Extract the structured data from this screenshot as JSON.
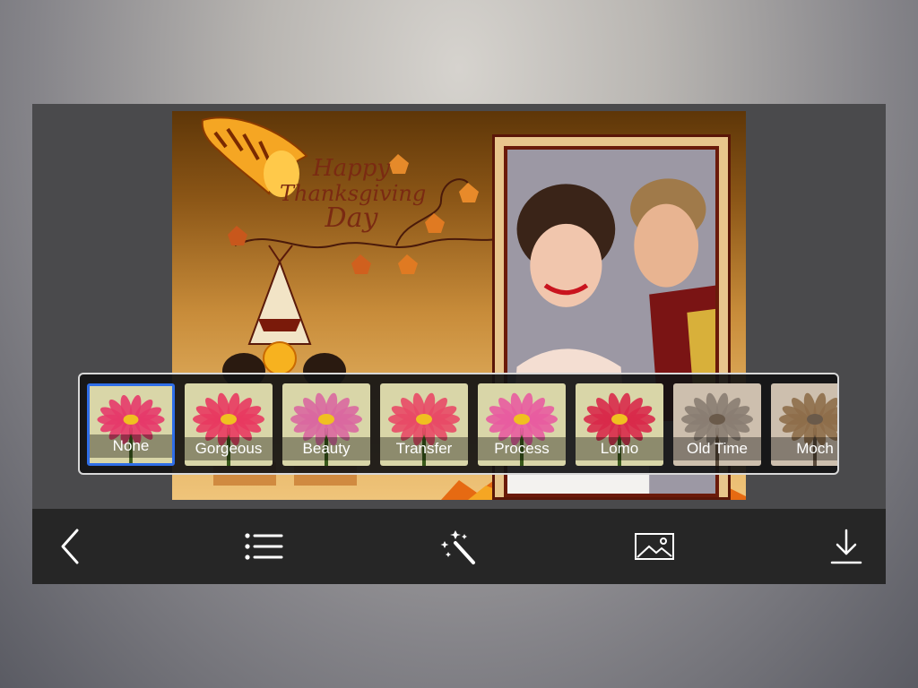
{
  "card": {
    "greeting_line1": "Happy",
    "greeting_line2": "Thanksgiving",
    "greeting_line3": "Day"
  },
  "filters": [
    {
      "label": "None",
      "selected": true,
      "tone": "#e63a6a"
    },
    {
      "label": "Gorgeous",
      "selected": false,
      "tone": "#e83a60"
    },
    {
      "label": "Beauty",
      "selected": false,
      "tone": "#d968a0"
    },
    {
      "label": "Transfer",
      "selected": false,
      "tone": "#e84a66"
    },
    {
      "label": "Process",
      "selected": false,
      "tone": "#e85ca0"
    },
    {
      "label": "Lomo",
      "selected": false,
      "tone": "#d82a4a"
    },
    {
      "label": "Old Time",
      "selected": false,
      "tone": "#8a7d72"
    },
    {
      "label": "Moch",
      "selected": false,
      "tone": "#8e6e4a"
    }
  ],
  "toolbar": {
    "items": [
      {
        "name": "back",
        "icon": "chevron-left-icon"
      },
      {
        "name": "list",
        "icon": "list-icon"
      },
      {
        "name": "effects",
        "icon": "magic-wand-icon"
      },
      {
        "name": "gallery",
        "icon": "image-icon"
      },
      {
        "name": "download",
        "icon": "download-icon"
      }
    ]
  },
  "colors": {
    "accent": "#2f6ee8",
    "app_background": "#4a4a4c",
    "toolbar_background": "#262626"
  }
}
